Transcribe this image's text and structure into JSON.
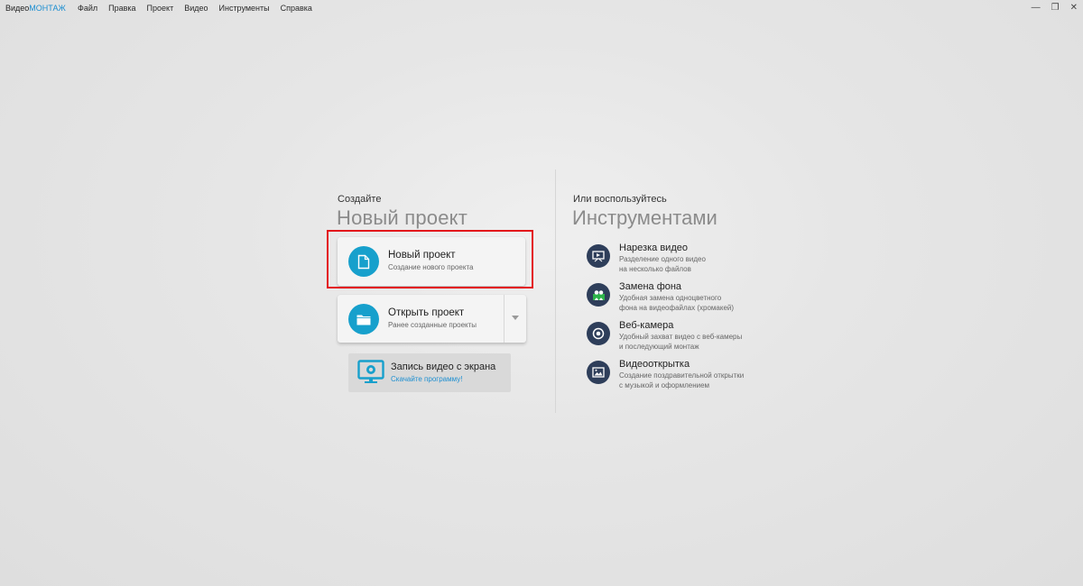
{
  "app": {
    "logo_part1": "Видео",
    "logo_part2": "МОНТАЖ",
    "accent_color": "#1d8fd1"
  },
  "menu": {
    "items": [
      "Файл",
      "Правка",
      "Проект",
      "Видео",
      "Инструменты",
      "Справка"
    ]
  },
  "window_controls": {
    "minimize": "—",
    "maximize": "❐",
    "close": "✕"
  },
  "create": {
    "caption": "Создайте",
    "title": "Новый проект",
    "new_project": {
      "title": "Новый проект",
      "subtitle": "Создание нового проекта",
      "icon": "document-icon"
    },
    "open_project": {
      "title": "Открыть проект",
      "subtitle": "Ранее созданные проекты",
      "icon": "folder-icon"
    },
    "record": {
      "title": "Запись видео с экрана",
      "link": "Скачайте программу!",
      "icon": "screen-record-icon"
    },
    "highlight_color": "#e3131b"
  },
  "tools": {
    "caption": "Или воспользуйтесь",
    "title": "Инструментами",
    "items": [
      {
        "title": "Нарезка видео",
        "desc_line1": "Разделение одного видео",
        "desc_line2": "на несколько файлов",
        "icon": "cut-video-icon"
      },
      {
        "title": "Замена фона",
        "desc_line1": "Удобная замена одноцветного",
        "desc_line2": "фона на видеофайлах (хромакей)",
        "icon": "chromakey-icon"
      },
      {
        "title": "Веб-камера",
        "desc_line1": "Удобный захват видео с веб-камеры",
        "desc_line2": "и последующий монтаж",
        "icon": "webcam-icon"
      },
      {
        "title": "Видеооткрытка",
        "desc_line1": "Создание поздравительной открытки",
        "desc_line2": "с музыкой и оформлением",
        "icon": "postcard-icon"
      }
    ]
  }
}
